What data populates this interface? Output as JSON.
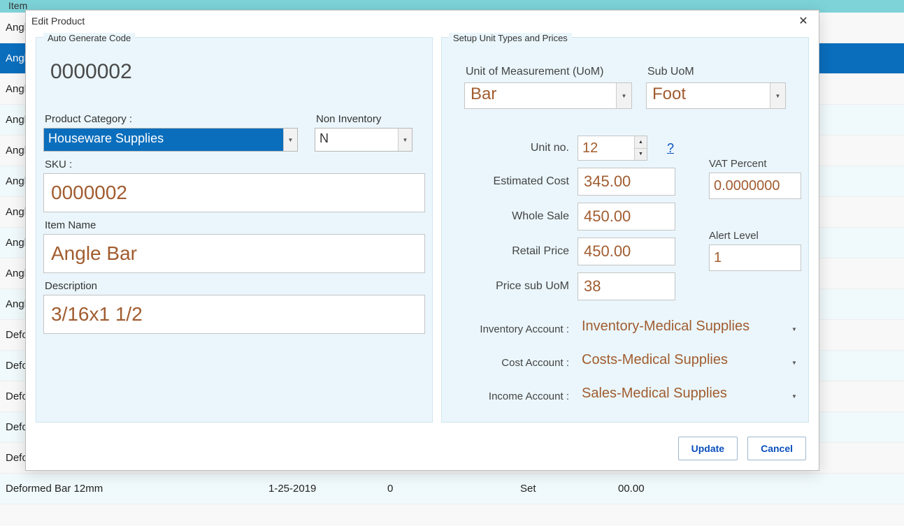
{
  "bg": {
    "header": {
      "c1": "Item",
      "c2": "",
      "c3": "",
      "c4": "",
      "c5": ""
    },
    "rows": [
      {
        "c1": "Angle",
        "c2": "",
        "c3": "",
        "c4": "",
        "c5": "",
        "sel": false,
        "alt": false
      },
      {
        "c1": "Angle",
        "c2": "",
        "c3": "",
        "c4": "",
        "c5": "",
        "sel": true,
        "alt": false
      },
      {
        "c1": "Angle",
        "c2": "",
        "c3": "",
        "c4": "",
        "c5": "",
        "sel": false,
        "alt": false
      },
      {
        "c1": "Angle",
        "c2": "",
        "c3": "",
        "c4": "",
        "c5": "",
        "sel": false,
        "alt": true
      },
      {
        "c1": "Angle",
        "c2": "",
        "c3": "",
        "c4": "",
        "c5": "",
        "sel": false,
        "alt": false
      },
      {
        "c1": "Angle",
        "c2": "",
        "c3": "",
        "c4": "",
        "c5": "",
        "sel": false,
        "alt": true
      },
      {
        "c1": "Angle",
        "c2": "",
        "c3": "",
        "c4": "",
        "c5": "",
        "sel": false,
        "alt": false
      },
      {
        "c1": "Angle",
        "c2": "",
        "c3": "",
        "c4": "",
        "c5": "",
        "sel": false,
        "alt": true
      },
      {
        "c1": "Angle",
        "c2": "",
        "c3": "",
        "c4": "",
        "c5": "",
        "sel": false,
        "alt": false
      },
      {
        "c1": "Angle",
        "c2": "",
        "c3": "",
        "c4": "",
        "c5": "",
        "sel": false,
        "alt": true
      },
      {
        "c1": "Defo",
        "c2": "",
        "c3": "",
        "c4": "",
        "c5": "",
        "sel": false,
        "alt": false
      },
      {
        "c1": "Defo",
        "c2": "",
        "c3": "",
        "c4": "",
        "c5": "",
        "sel": false,
        "alt": true
      },
      {
        "c1": "Defo",
        "c2": "",
        "c3": "",
        "c4": "",
        "c5": "",
        "sel": false,
        "alt": false
      },
      {
        "c1": "Defo",
        "c2": "",
        "c3": "",
        "c4": "",
        "c5": "",
        "sel": false,
        "alt": true
      },
      {
        "c1": "Defo",
        "c2": "",
        "c3": "",
        "c4": "",
        "c5": "",
        "sel": false,
        "alt": false
      },
      {
        "c1": "Deformed Bar 12mm",
        "c2": "1-25-2019",
        "c3": "0",
        "c4": "Set",
        "c5": "00.00",
        "sel": false,
        "alt": true
      }
    ]
  },
  "dialog": {
    "title": "Edit Product",
    "left": {
      "legend": "Auto Generate Code",
      "code": "0000002",
      "category_label": "Product Category :",
      "category_value": "Houseware Supplies",
      "noninv_label": "Non Inventory",
      "noninv_value": "N",
      "sku_label": "SKU :",
      "sku_value": "0000002",
      "itemname_label": "Item Name",
      "itemname_value": "Angle Bar",
      "desc_label": "Description",
      "desc_value": "3/16x1 1/2"
    },
    "right": {
      "legend": "Setup Unit Types and Prices",
      "uom_label": "Unit of Measurement (UoM)",
      "uom_value": "Bar",
      "subuom_label": "Sub UoM",
      "subuom_value": "Foot",
      "unitno_label": "Unit no.",
      "unitno_value": "12",
      "question": "?",
      "estcost_label": "Estimated Cost",
      "estcost_value": "345.00",
      "wholesale_label": "Whole Sale",
      "wholesale_value": "450.00",
      "retail_label": "Retail Price",
      "retail_value": "450.00",
      "pricesub_label": "Price sub UoM",
      "pricesub_value": "38",
      "vat_label": "VAT Percent",
      "vat_value": "0.0000000",
      "alert_label": "Alert Level",
      "alert_value": "1",
      "invacct_label": "Inventory Account :",
      "invacct_value": "Inventory-Medical Supplies",
      "costacct_label": "Cost Account :",
      "costacct_value": "Costs-Medical Supplies",
      "incomeacct_label": "Income Account :",
      "incomeacct_value": "Sales-Medical Supplies"
    },
    "buttons": {
      "update": "Update",
      "cancel": "Cancel"
    }
  }
}
